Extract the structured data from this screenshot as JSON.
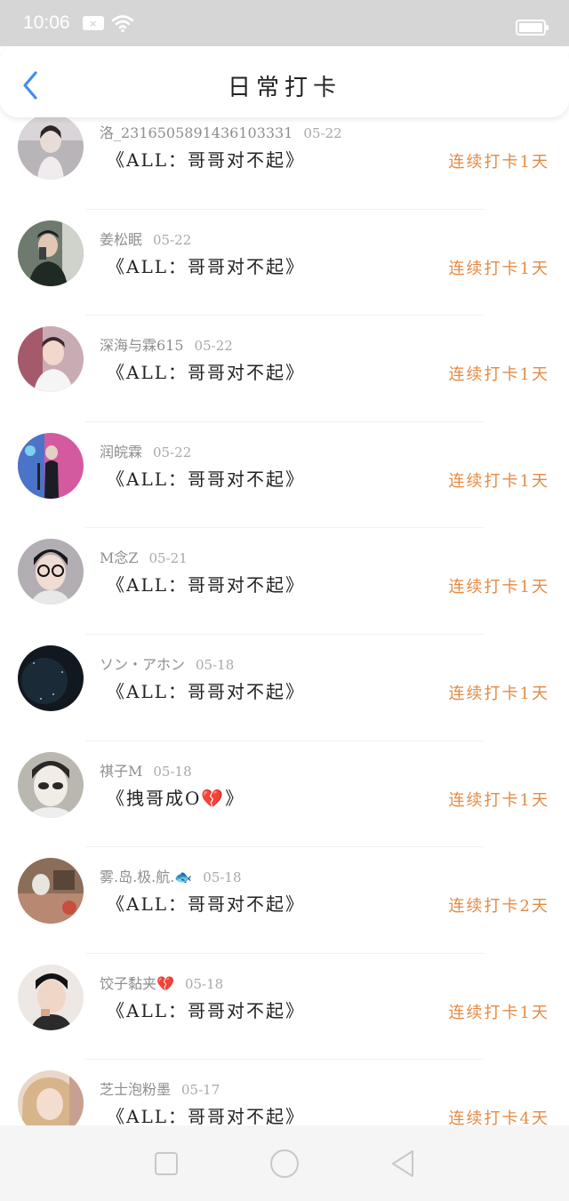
{
  "status_bar": {
    "time": "10:06",
    "notification_glyph": "×",
    "icons": [
      "notification-icon",
      "wifi-icon",
      "battery-icon"
    ]
  },
  "header": {
    "title": "日常打卡",
    "back_icon": "chevron-left-icon",
    "accent_color": "#3f8fe8"
  },
  "colors": {
    "streak": "#e58a42",
    "username": "#8e8e8e",
    "content": "#222222"
  },
  "checkins": [
    {
      "username": "洛_2316505891436103331",
      "date": "05-22",
      "content": "《ALL：哥哥对不起》",
      "streak": "连续打卡1天"
    },
    {
      "username": "姜松眠",
      "date": "05-22",
      "content": "《ALL：哥哥对不起》",
      "streak": "连续打卡1天"
    },
    {
      "username": "深海与霖615",
      "date": "05-22",
      "content": "《ALL：哥哥对不起》",
      "streak": "连续打卡1天"
    },
    {
      "username": "润皖霖",
      "date": "05-22",
      "content": "《ALL：哥哥对不起》",
      "streak": "连续打卡1天"
    },
    {
      "username": "M念Z",
      "date": "05-21",
      "content": "《ALL：哥哥对不起》",
      "streak": "连续打卡1天"
    },
    {
      "username": "ソン・アホン",
      "date": "05-18",
      "content": "《ALL：哥哥对不起》",
      "streak": "连续打卡1天"
    },
    {
      "username": "祺子M",
      "date": "05-18",
      "content": "《拽哥成O💔》",
      "streak": "连续打卡1天"
    },
    {
      "username": "雾.岛.极.航.🐟",
      "date": "05-18",
      "content": "《ALL：哥哥对不起》",
      "streak": "连续打卡2天"
    },
    {
      "username": "饺子黏夹💔",
      "date": "05-18",
      "content": "《ALL：哥哥对不起》",
      "streak": "连续打卡1天"
    },
    {
      "username": "芝士泡粉墨",
      "date": "05-17",
      "content": "《ALL：哥哥对不起》",
      "streak": "连续打卡4天"
    }
  ],
  "nav_bar": {
    "icons": [
      "recents-square-icon",
      "home-circle-icon",
      "back-triangle-icon"
    ]
  }
}
